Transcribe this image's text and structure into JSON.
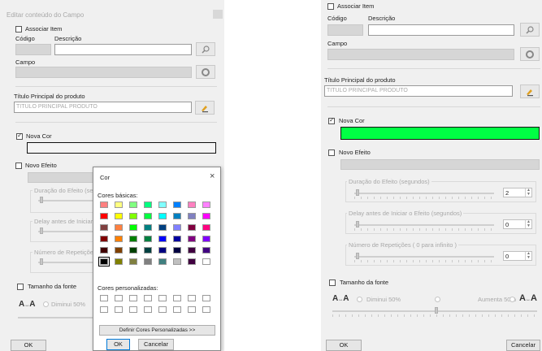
{
  "left": {
    "title": "Editar conteúdo do Campo",
    "associar_item": "Associar Item",
    "codigo": "Código",
    "descricao": "Descrição",
    "campo": "Campo",
    "titulo_principal_label": "Título Principal do produto",
    "titulo_principal_value": "TITULO PRINCIPAL PRODUTO",
    "nova_cor": "Nova Cor",
    "novo_efeito": "Novo Efeito",
    "duracao": "Duração do Efeito (seg",
    "delay": "Delay antes de Iniciar",
    "numero_rep": "Número de Repetiçõe",
    "tamanho_fonte": "Tamanho da fonte",
    "diminui": "Diminui 50%",
    "ok": "OK"
  },
  "color_dialog": {
    "title": "Cor",
    "close": "×",
    "basic_label": "Cores básicas:",
    "custom_label": "Cores personalizadas:",
    "define_button": "Definir Cores Personalizadas >>",
    "ok": "OK",
    "cancel": "Cancelar",
    "basic_colors": [
      "#ff8080",
      "#ffff80",
      "#80ff80",
      "#00ff80",
      "#80ffff",
      "#0080ff",
      "#ff80c0",
      "#ff80ff",
      "#ff0000",
      "#ffff00",
      "#80ff00",
      "#00ff40",
      "#00ffff",
      "#0080c0",
      "#8080c0",
      "#ff00ff",
      "#804040",
      "#ff8040",
      "#00ff00",
      "#008080",
      "#004080",
      "#8080ff",
      "#800040",
      "#ff0080",
      "#800000",
      "#ff8000",
      "#008000",
      "#008040",
      "#0000ff",
      "#0000a0",
      "#800080",
      "#8000ff",
      "#400000",
      "#804000",
      "#004000",
      "#004040",
      "#000080",
      "#000040",
      "#400040",
      "#400080",
      "#000000",
      "#808000",
      "#808040",
      "#808080",
      "#408080",
      "#c0c0c0",
      "#400040",
      "#ffffff"
    ]
  },
  "right": {
    "associar_item": "Associar Item",
    "codigo": "Código",
    "descricao": "Descrição",
    "campo": "Campo",
    "titulo_principal_label": "Título Principal do produto",
    "titulo_principal_value": "TITULO PRINCIPAL PRODUTO",
    "nova_cor": "Nova Cor",
    "nova_cor_value": "#00ff44",
    "novo_efeito": "Novo Efeito",
    "duracao": "Duração do Efeito (segundos)",
    "duracao_value": "2",
    "delay": "Delay antes de Iniciar o Efeito (segundos)",
    "delay_value": "0",
    "numero_rep": "Número de Repetições ( 0 para infinito )",
    "numero_rep_value": "0",
    "tamanho_fonte": "Tamanho da fonte",
    "diminui": "Diminui 50%",
    "aumenta": "Aumenta 50%",
    "ok": "OK",
    "cancelar": "Cancelar"
  },
  "icons": {
    "search": "search-icon",
    "refresh": "refresh-icon",
    "pencil": "pencil-icon",
    "font_small": "font-decrease-icon",
    "font_large": "font-increase-icon"
  }
}
